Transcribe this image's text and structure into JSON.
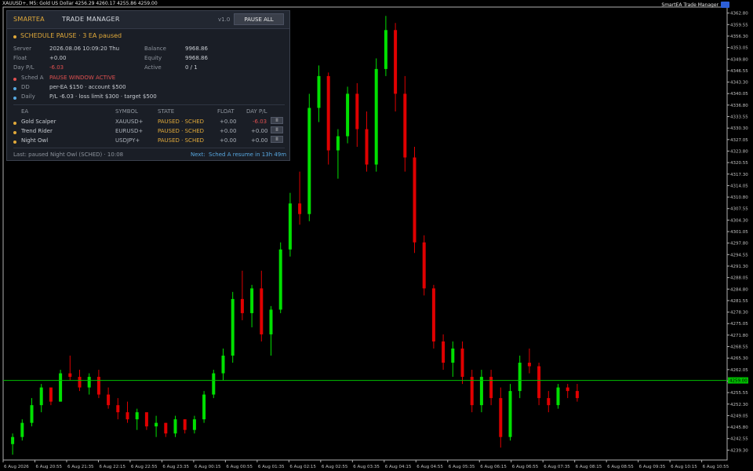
{
  "topbar": {
    "text": "XAUUSD+, M5: Gold US Dollar 4256.29 4260.17 4255.86 4259.00"
  },
  "brand_top_right": "SmartEA Trade Manager",
  "panel": {
    "brand": "SMARTEA",
    "title": "TRADE MANAGER",
    "version": "v1.0",
    "pause_all": "PAUSE ALL",
    "status": "SCHEDULE PAUSE · 3 EA paused",
    "server_label": "Server",
    "server_value": "2026.08.06 10:09:20 Thu",
    "float_label": "Float",
    "float_value": "+0.00",
    "daypl_label": "Day P/L",
    "daypl_value": "-6.03",
    "balance_label": "Balance",
    "balance_value": "9968.86",
    "equity_label": "Equity",
    "equity_value": "9968.86",
    "active_label": "Active",
    "active_value": "0 / 1",
    "sched_label": "Sched A",
    "sched_value": "PAUSE WINDOW ACTIVE",
    "dd_label": "DD",
    "dd_value": "per-EA $150  ·  account $500",
    "daily_label": "Daily",
    "daily_value": "P/L -6.03  ·  loss limit $300  ·  target $500",
    "columns": [
      "EA",
      "SYMBOL",
      "STATE",
      "FLOAT",
      "DAY P/L"
    ],
    "rows": [
      {
        "ea": "Gold Scalper",
        "symbol": "XAUUSD+",
        "state": "PAUSED · SCHED",
        "float": "+0.00",
        "daypl": "-6.03",
        "btn": "II"
      },
      {
        "ea": "Trend Rider",
        "symbol": "EURUSD+",
        "state": "PAUSED · SCHED",
        "float": "+0.00",
        "daypl": "+0.00",
        "btn": "II"
      },
      {
        "ea": "Night Owl",
        "symbol": "USDJPY+",
        "state": "PAUSED · SCHED",
        "float": "+0.00",
        "daypl": "+0.00",
        "btn": "II"
      }
    ],
    "last": "Last:  paused Night Owl (SCHED) · 10:08",
    "next_label": "Next:",
    "next_value": "Sched A resume in 13h 49m"
  },
  "colors": {
    "bull": "#00e000",
    "bear": "#e00000",
    "accent": "#e0a93a",
    "alert": "#e05050",
    "info": "#58a8e0",
    "price_line": "#00c000"
  },
  "chart_data": {
    "type": "candlestick",
    "symbol": "XAUUSD+",
    "timeframe": "M5",
    "current_price": "4259.00",
    "ylim": [
      4236.5,
      4364.5
    ],
    "y_ticks": [
      "4362.80",
      "4359.55",
      "4356.30",
      "4353.05",
      "4349.80",
      "4346.55",
      "4343.30",
      "4340.05",
      "4336.80",
      "4333.55",
      "4330.30",
      "4327.05",
      "4323.80",
      "4320.55",
      "4317.30",
      "4314.05",
      "4310.80",
      "4307.55",
      "4304.30",
      "4301.05",
      "4297.80",
      "4294.55",
      "4291.30",
      "4288.05",
      "4284.80",
      "4281.55",
      "4278.30",
      "4275.05",
      "4271.80",
      "4268.55",
      "4265.30",
      "4262.05",
      "4258.80",
      "4255.55",
      "4252.30",
      "4249.05",
      "4245.80",
      "4242.55",
      "4239.30"
    ],
    "x_ticks": [
      "6 Aug 2026",
      "6 Aug 20:55",
      "6 Aug 21:35",
      "6 Aug 22:15",
      "6 Aug 22:55",
      "6 Aug 23:35",
      "6 Aug 00:15",
      "6 Aug 00:55",
      "6 Aug 01:35",
      "6 Aug 02:15",
      "6 Aug 02:55",
      "6 Aug 03:35",
      "6 Aug 04:15",
      "6 Aug 04:55",
      "6 Aug 05:35",
      "6 Aug 06:15",
      "6 Aug 06:55",
      "6 Aug 07:35",
      "6 Aug 08:15",
      "6 Aug 08:55",
      "6 Aug 09:35",
      "6 Aug 10:15",
      "6 Aug 10:55"
    ],
    "candles": [
      [
        4241,
        4244,
        4238,
        4243
      ],
      [
        4243,
        4248,
        4242,
        4247
      ],
      [
        4247,
        4254,
        4246,
        4252
      ],
      [
        4252,
        4258,
        4250,
        4257
      ],
      [
        4257,
        4256,
        4252,
        4253
      ],
      [
        4253,
        4262,
        4253,
        4261
      ],
      [
        4261,
        4266,
        4259,
        4260
      ],
      [
        4260,
        4262,
        4256,
        4257
      ],
      [
        4257,
        4261,
        4255,
        4260
      ],
      [
        4260,
        4262,
        4254,
        4255
      ],
      [
        4255,
        4257,
        4251,
        4252
      ],
      [
        4252,
        4254,
        4248,
        4250
      ],
      [
        4250,
        4253,
        4247,
        4248
      ],
      [
        4248,
        4251,
        4245,
        4250
      ],
      [
        4250,
        4249,
        4245,
        4246
      ],
      [
        4246,
        4249,
        4243,
        4247
      ],
      [
        4247,
        4247,
        4243,
        4244
      ],
      [
        4244,
        4249,
        4243,
        4248
      ],
      [
        4248,
        4248,
        4244,
        4245
      ],
      [
        4245,
        4249,
        4244,
        4248
      ],
      [
        4248,
        4256,
        4247,
        4255
      ],
      [
        4255,
        4262,
        4254,
        4261
      ],
      [
        4261,
        4268,
        4259,
        4266
      ],
      [
        4266,
        4284,
        4264,
        4282
      ],
      [
        4282,
        4290,
        4276,
        4278
      ],
      [
        4278,
        4286,
        4274,
        4285
      ],
      [
        4285,
        4290,
        4270,
        4272
      ],
      [
        4272,
        4280,
        4266,
        4279
      ],
      [
        4279,
        4298,
        4278,
        4296
      ],
      [
        4296,
        4312,
        4294,
        4309
      ],
      [
        4309,
        4318,
        4303,
        4306
      ],
      [
        4306,
        4340,
        4304,
        4336
      ],
      [
        4336,
        4348,
        4332,
        4345
      ],
      [
        4345,
        4346,
        4320,
        4324
      ],
      [
        4324,
        4330,
        4316,
        4328
      ],
      [
        4328,
        4342,
        4326,
        4340
      ],
      [
        4340,
        4343,
        4325,
        4330
      ],
      [
        4330,
        4335,
        4318,
        4320
      ],
      [
        4320,
        4350,
        4318,
        4347
      ],
      [
        4347,
        4362,
        4345,
        4358
      ],
      [
        4358,
        4360,
        4335,
        4340
      ],
      [
        4340,
        4345,
        4318,
        4322
      ],
      [
        4322,
        4325,
        4295,
        4298
      ],
      [
        4298,
        4300,
        4283,
        4285
      ],
      [
        4285,
        4286,
        4268,
        4270
      ],
      [
        4270,
        4272,
        4262,
        4264
      ],
      [
        4264,
        4270,
        4260,
        4268
      ],
      [
        4268,
        4270,
        4258,
        4260
      ],
      [
        4260,
        4262,
        4250,
        4252
      ],
      [
        4252,
        4262,
        4250,
        4260
      ],
      [
        4260,
        4262,
        4252,
        4254
      ],
      [
        4254,
        4257,
        4240,
        4243
      ],
      [
        4243,
        4258,
        4242,
        4256
      ],
      [
        4256,
        4266,
        4254,
        4264
      ],
      [
        4264,
        4268,
        4261,
        4263
      ],
      [
        4263,
        4264,
        4252,
        4254
      ],
      [
        4254,
        4256,
        4250,
        4252
      ],
      [
        4252,
        4258,
        4251,
        4257
      ],
      [
        4257,
        4258,
        4254,
        4256
      ],
      [
        4256,
        4258,
        4253,
        4254
      ]
    ]
  }
}
